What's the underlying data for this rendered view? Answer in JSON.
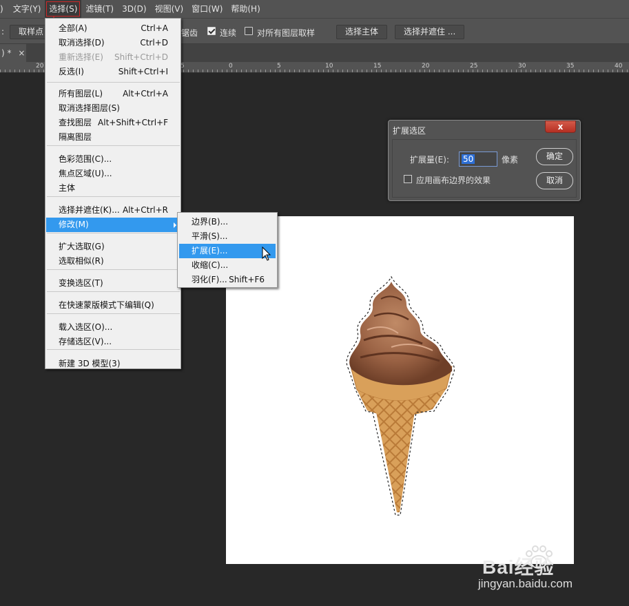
{
  "menubar": {
    "items": [
      ")",
      "文字(Y)",
      "选择(S)",
      "滤镜(T)",
      "3D(D)",
      "视图(V)",
      "窗口(W)",
      "帮助(H)"
    ]
  },
  "optbar": {
    "prefix": ":",
    "sample_label": "取样点",
    "antialias_label": "锯齿",
    "contiguous_label": "连续",
    "all_layers_label": "对所有图层取样",
    "select_subject": "选择主体",
    "select_mask": "选择并遮住 ..."
  },
  "tab": {
    "label": ") *",
    "close": "×"
  },
  "ruler": {
    "numbers": [
      "20",
      "5",
      "0",
      "5",
      "10",
      "15",
      "20",
      "25",
      "30",
      "35",
      "40"
    ]
  },
  "select_menu": {
    "items": [
      {
        "label": "全部(A)",
        "shortcut": "Ctrl+A"
      },
      {
        "label": "取消选择(D)",
        "shortcut": "Ctrl+D"
      },
      {
        "label": "重新选择(E)",
        "shortcut": "Shift+Ctrl+D"
      },
      {
        "label": "反选(I)",
        "shortcut": "Shift+Ctrl+I"
      },
      {
        "label": "所有图层(L)",
        "shortcut": "Alt+Ctrl+A"
      },
      {
        "label": "取消选择图层(S)",
        "shortcut": ""
      },
      {
        "label": "查找图层",
        "shortcut": "Alt+Shift+Ctrl+F"
      },
      {
        "label": "隔离图层",
        "shortcut": ""
      },
      {
        "label": "色彩范围(C)...",
        "shortcut": ""
      },
      {
        "label": "焦点区域(U)...",
        "shortcut": ""
      },
      {
        "label": "主体",
        "shortcut": ""
      },
      {
        "label": "选择并遮住(K)...",
        "shortcut": "Alt+Ctrl+R"
      },
      {
        "label": "修改(M)",
        "shortcut": ""
      },
      {
        "label": "扩大选取(G)",
        "shortcut": ""
      },
      {
        "label": "选取相似(R)",
        "shortcut": ""
      },
      {
        "label": "变换选区(T)",
        "shortcut": ""
      },
      {
        "label": "在快速蒙版模式下编辑(Q)",
        "shortcut": ""
      },
      {
        "label": "载入选区(O)...",
        "shortcut": ""
      },
      {
        "label": "存储选区(V)...",
        "shortcut": ""
      },
      {
        "label": "新建 3D 模型(3)",
        "shortcut": ""
      }
    ]
  },
  "modify_submenu": {
    "items": [
      {
        "label": "边界(B)...",
        "shortcut": ""
      },
      {
        "label": "平滑(S)...",
        "shortcut": ""
      },
      {
        "label": "扩展(E)...",
        "shortcut": ""
      },
      {
        "label": "收缩(C)...",
        "shortcut": ""
      },
      {
        "label": "羽化(F)...",
        "shortcut": "Shift+F6"
      }
    ]
  },
  "dialog": {
    "title": "扩展选区",
    "close": "x",
    "amount_label": "扩展量(E):",
    "amount_value": "50",
    "unit": "像素",
    "canvas_bounds_label": "应用画布边界的效果",
    "ok": "确定",
    "cancel": "取消"
  },
  "watermark": {
    "logo_text": "Bai经验",
    "url": "jingyan.baidu.com"
  },
  "colors": {
    "highlight": "#3399ee",
    "menubar": "#535353",
    "workspace": "#282828",
    "annotation": "#d02828"
  }
}
